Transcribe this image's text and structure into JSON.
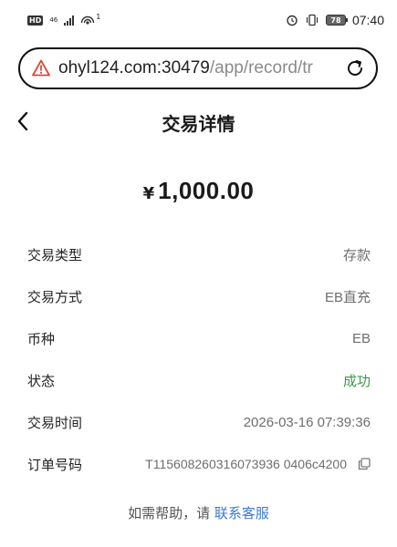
{
  "status_bar": {
    "hd_badge": "HD",
    "network": "4G",
    "network_sub": "46",
    "wifi_level": "1",
    "battery": "78",
    "time": "07:40"
  },
  "browser": {
    "url_host": "ohyl124.com:30479",
    "url_path": "/app/record/tr"
  },
  "page": {
    "title": "交易详情",
    "currency_symbol": "¥",
    "amount": "1,000.00",
    "rows": [
      {
        "label": "交易类型",
        "value": "存款"
      },
      {
        "label": "交易方式",
        "value": "EB直充"
      },
      {
        "label": "币种",
        "value": "EB"
      },
      {
        "label": "状态",
        "value": "成功"
      },
      {
        "label": "交易时间",
        "value": "2026-03-16 07:39:36"
      },
      {
        "label": "订单号码",
        "value": "T115608260316073936 0406c4200"
      }
    ],
    "help_prefix": "如需帮助，请 ",
    "help_link": "联系客服"
  },
  "colors": {
    "success": "#3c9a44",
    "link": "#3a7bd5"
  }
}
